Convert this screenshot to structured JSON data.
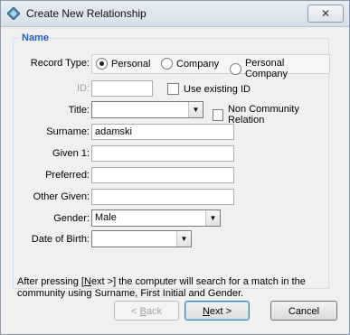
{
  "window": {
    "title": "Create New Relationship",
    "close_glyph": "✕"
  },
  "group": {
    "legend": "Name"
  },
  "record_type": {
    "label": "Record Type:",
    "options": [
      "Personal",
      "Company",
      "Personal Company"
    ],
    "selected": "Personal"
  },
  "id": {
    "label": "ID:",
    "value": "",
    "use_existing_label": "Use existing ID",
    "use_existing_checked": false
  },
  "title": {
    "label": "Title:",
    "value": "",
    "non_community_label": "Non Community Relation",
    "non_community_checked": false
  },
  "surname": {
    "label": "Surname:",
    "value": "adamski"
  },
  "given1": {
    "label": "Given 1:",
    "value": ""
  },
  "preferred": {
    "label": "Preferred:",
    "value": ""
  },
  "other_given": {
    "label": "Other Given:",
    "value": ""
  },
  "gender": {
    "label": "Gender:",
    "value": "Male"
  },
  "dob": {
    "label": "Date of Birth:",
    "value": ""
  },
  "footer": {
    "text_before": "After pressing [",
    "next_key": "N",
    "text_after": "ext >] the computer will search for a match in the community using Surname, First Initial and Gender."
  },
  "buttons": {
    "back_prefix": "< ",
    "back_key": "B",
    "back_rest": "ack",
    "next_key": "N",
    "next_rest": "ext >",
    "cancel": "Cancel"
  },
  "icons": {
    "app": "diamond-app-icon",
    "close": "close-icon",
    "dropdown": "chevron-down-icon",
    "radio": "radio-icon",
    "checkbox": "checkbox-icon"
  }
}
